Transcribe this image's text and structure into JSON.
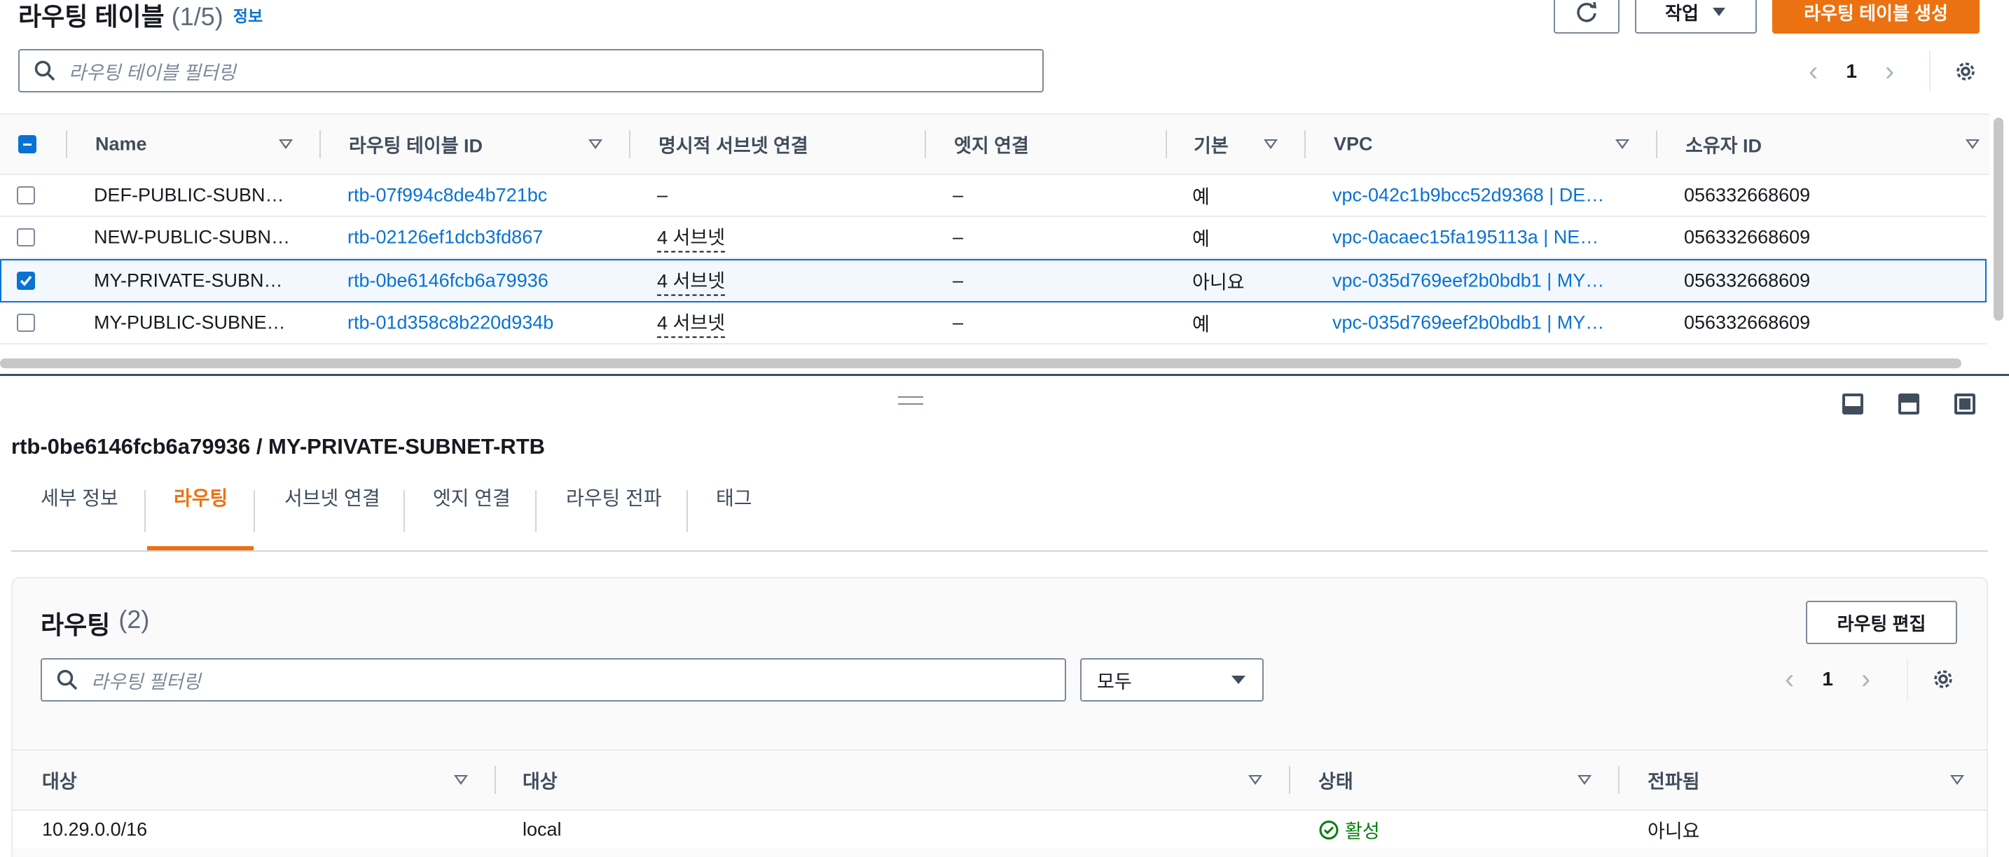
{
  "header": {
    "title": "라우팅 테이블",
    "count": "(1/5)",
    "info": "정보",
    "actions_label": "작업",
    "create_label": "라우팅 테이블 생성",
    "filter_placeholder": "라우팅 테이블 필터링",
    "page": "1"
  },
  "table": {
    "columns": [
      "Name",
      "라우팅 테이블 ID",
      "명시적 서브넷 연결",
      "엣지 연결",
      "기본",
      "VPC",
      "소유자 ID"
    ],
    "rows": [
      {
        "name": "DEF-PUBLIC-SUBN…",
        "id": "rtb-07f994c8de4b721bc",
        "subnets": "–",
        "edge": "–",
        "main": "예",
        "vpc": "vpc-042c1b9bcc52d9368 | DE…",
        "owner": "056332668609",
        "selected": false
      },
      {
        "name": "NEW-PUBLIC-SUBN…",
        "id": "rtb-02126ef1dcb3fd867",
        "subnets": "4 서브넷",
        "edge": "–",
        "main": "예",
        "vpc": "vpc-0acaec15fa195113a | NE…",
        "owner": "056332668609",
        "selected": false
      },
      {
        "name": "MY-PRIVATE-SUBN…",
        "id": "rtb-0be6146fcb6a79936",
        "subnets": "4 서브넷",
        "edge": "–",
        "main": "아니요",
        "vpc": "vpc-035d769eef2b0bdb1 | MY…",
        "owner": "056332668609",
        "selected": true
      },
      {
        "name": "MY-PUBLIC-SUBNE…",
        "id": "rtb-01d358c8b220d934b",
        "subnets": "4 서브넷",
        "edge": "–",
        "main": "예",
        "vpc": "vpc-035d769eef2b0bdb1 | MY…",
        "owner": "056332668609",
        "selected": false
      }
    ]
  },
  "detail": {
    "heading": "rtb-0be6146fcb6a79936 / MY-PRIVATE-SUBNET-RTB",
    "tabs": [
      "세부 정보",
      "라우팅",
      "서브넷 연결",
      "엣지 연결",
      "라우팅 전파",
      "태그"
    ],
    "active_tab": 1
  },
  "routes": {
    "title": "라우팅",
    "count": "(2)",
    "edit_label": "라우팅 편집",
    "filter_placeholder": "라우팅 필터링",
    "select_value": "모두",
    "page": "1",
    "columns": [
      "대상",
      "대상",
      "상태",
      "전파됨"
    ],
    "rows": [
      {
        "destination": "10.29.0.0/16",
        "target": "local",
        "status": "활성",
        "propagated": "아니요"
      }
    ]
  },
  "colors": {
    "accent": "#ec7211",
    "link": "#0972d3",
    "success": "#037f0c"
  },
  "icons": [
    "refresh-icon",
    "caret-down-icon",
    "search-icon",
    "chevron-left-icon",
    "chevron-right-icon",
    "gear-icon",
    "drag-handle-icon",
    "panel-bottom-icon",
    "panel-side-icon",
    "panel-full-icon",
    "status-success-icon"
  ]
}
